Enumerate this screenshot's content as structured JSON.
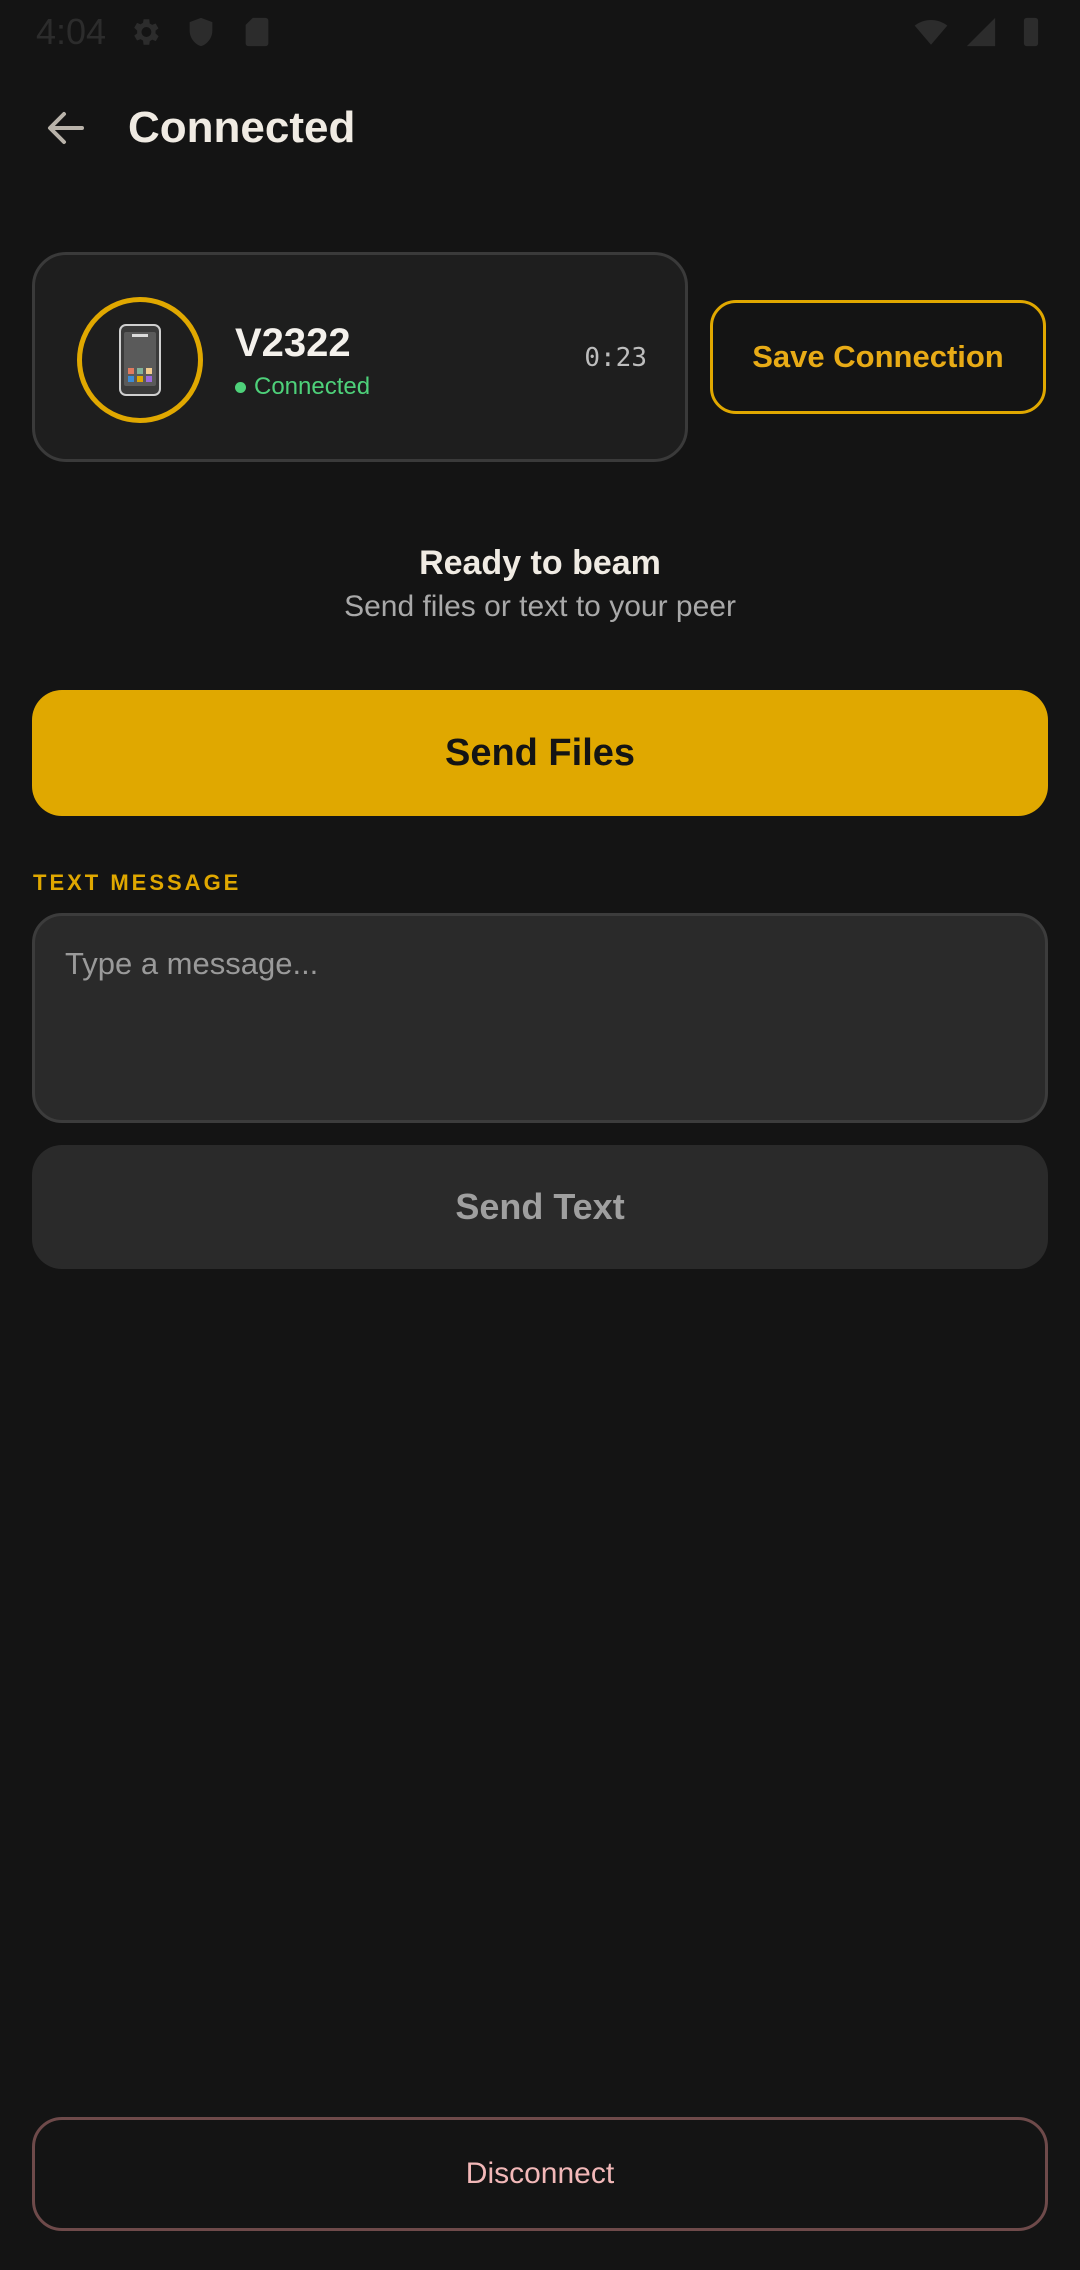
{
  "status_bar": {
    "time": "4:04",
    "left_icons": [
      "gear-icon",
      "shield-icon",
      "sd-card-icon"
    ],
    "right_icons": [
      "wifi-icon",
      "cell-signal-icon",
      "battery-icon"
    ]
  },
  "app_bar": {
    "title": "Connected",
    "back_icon": "arrow-left-icon"
  },
  "peer": {
    "name": "V2322",
    "status": "Connected",
    "timer": "0:23",
    "avatar_icon": "phone-icon"
  },
  "save_connection_label": "Save Connection",
  "ready": {
    "title": "Ready to beam",
    "subtitle": "Send files or text to your peer"
  },
  "send_files_label": "Send Files",
  "text_message": {
    "section_label": "TEXT MESSAGE",
    "placeholder": "Type a message...",
    "value": ""
  },
  "send_text_label": "Send Text",
  "disconnect_label": "Disconnect",
  "colors": {
    "background": "#141414",
    "accent": "#e0a800",
    "connected": "#4ed17a",
    "danger_text": "#f2b8b8"
  }
}
